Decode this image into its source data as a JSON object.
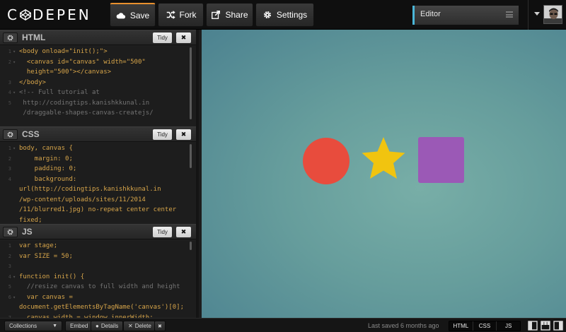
{
  "header": {
    "logo_text": "CODEPEN",
    "buttons": {
      "save": "Save",
      "fork": "Fork",
      "share": "Share",
      "settings": "Settings"
    },
    "view_select": "Editor"
  },
  "panels": {
    "html": {
      "title": "HTML",
      "tidy": "Tidy",
      "lines": [
        {
          "num": "1",
          "fold": "▾",
          "text": "<body onload=\"init();\">",
          "kind": "code"
        },
        {
          "num": "2",
          "fold": "▾",
          "text": "  <canvas id=\"canvas\" width=\"500\"",
          "kind": "code"
        },
        {
          "num": "",
          "fold": "",
          "text": "  height=\"500\"></canvas>",
          "kind": "code"
        },
        {
          "num": "3",
          "fold": "",
          "text": "</body>",
          "kind": "code"
        },
        {
          "num": "4",
          "fold": "▾",
          "text": "<!-- Full tutorial at",
          "kind": "comment"
        },
        {
          "num": "5",
          "fold": "",
          "text": " http://codingtips.kanishkkunal.in",
          "kind": "comment"
        },
        {
          "num": "",
          "fold": "",
          "text": " /draggable-shapes-canvas-createjs/",
          "kind": "comment"
        }
      ]
    },
    "css": {
      "title": "CSS",
      "tidy": "Tidy",
      "lines": [
        {
          "num": "1",
          "fold": "▾",
          "text": "body, canvas {",
          "kind": "code"
        },
        {
          "num": "2",
          "fold": "",
          "text": "    margin: 0;",
          "kind": "code"
        },
        {
          "num": "3",
          "fold": "",
          "text": "    padding: 0;",
          "kind": "code"
        },
        {
          "num": "4",
          "fold": "",
          "text": "    background:",
          "kind": "code"
        },
        {
          "num": "",
          "fold": "",
          "text": "url(http://codingtips.kanishkkunal.in",
          "kind": "code"
        },
        {
          "num": "",
          "fold": "",
          "text": "/wp-content/uploads/sites/11/2014",
          "kind": "code"
        },
        {
          "num": "",
          "fold": "",
          "text": "/11/blurred1.jpg) no-repeat center center",
          "kind": "code"
        },
        {
          "num": "",
          "fold": "",
          "text": "fixed;",
          "kind": "code"
        }
      ]
    },
    "js": {
      "title": "JS",
      "tidy": "Tidy",
      "lines": [
        {
          "num": "1",
          "fold": "",
          "text": "var stage;",
          "kind": "code"
        },
        {
          "num": "2",
          "fold": "",
          "text": "var SIZE = 50;",
          "kind": "code"
        },
        {
          "num": "3",
          "fold": "",
          "text": "",
          "kind": "code"
        },
        {
          "num": "4",
          "fold": "▾",
          "text": "function init() {",
          "kind": "code"
        },
        {
          "num": "5",
          "fold": "",
          "text": "  //resize canvas to full width and height",
          "kind": "comment"
        },
        {
          "num": "6",
          "fold": "▾",
          "text": "  var canvas =",
          "kind": "code"
        },
        {
          "num": "",
          "fold": "",
          "text": "document.getElementsByTagName('canvas')[0];",
          "kind": "code"
        },
        {
          "num": "7",
          "fold": "",
          "text": "  canvas.width = window.innerWidth;",
          "kind": "code"
        }
      ]
    }
  },
  "preview": {
    "shapes": [
      {
        "kind": "circle",
        "color": "#e84c3d",
        "label": "red-circle"
      },
      {
        "kind": "star",
        "color": "#f1c40f",
        "label": "yellow-star"
      },
      {
        "kind": "square",
        "color": "#9b59b6",
        "label": "purple-square"
      }
    ]
  },
  "footer": {
    "collections": "Collections",
    "embed": "Embed",
    "details": "Details",
    "delete": "Delete",
    "last_saved": "Last saved 6 months ago",
    "toggles": [
      "HTML",
      "CSS",
      "JS"
    ]
  }
}
